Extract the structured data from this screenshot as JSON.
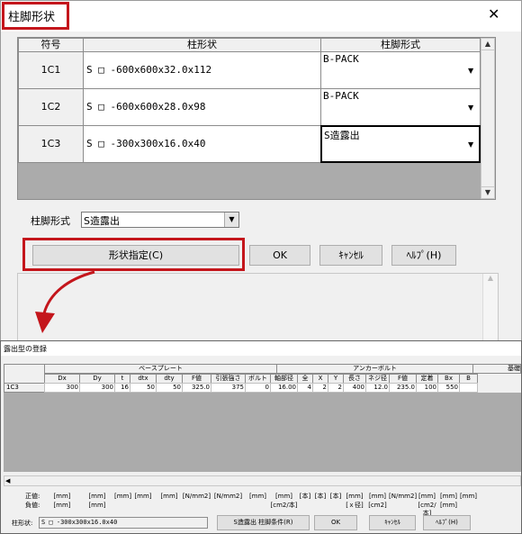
{
  "window": {
    "title": "柱脚形状",
    "close_glyph": "✕"
  },
  "table": {
    "headers": [
      "符号",
      "柱形状",
      "柱脚形式"
    ],
    "rows": [
      {
        "code": "1C1",
        "shape": "S □ -600x600x32.0x112",
        "base": "B-PACK"
      },
      {
        "code": "1C2",
        "shape": "S □ -600x600x28.0x98",
        "base": "B-PACK"
      },
      {
        "code": "1C3",
        "shape": "S □ -300x300x16.0x40",
        "base": "S造露出"
      }
    ]
  },
  "form": {
    "base_type_label": "柱脚形式",
    "base_type_value": "S造露出"
  },
  "buttons": {
    "shape_spec": "形状指定(C)",
    "ok": "OK",
    "cancel": "ｷｬﾝｾﾙ",
    "help": "ﾍﾙﾌﾟ(H)"
  },
  "inset": {
    "title": "露出型の登録",
    "group_baseplate": "ベースプレート",
    "group_anchor": "アンカーボルト",
    "group_base": "基礎",
    "cols": [
      "Dx",
      "Dy",
      "t",
      "dtx",
      "dty",
      "F値",
      "引張強さ",
      "ボルト孔",
      "軸部径",
      "全",
      "X",
      "Y",
      "長さ",
      "ネジ径",
      "F値",
      "定着",
      "Bx",
      "B"
    ],
    "row": {
      "code": "1C3",
      "values": [
        "300",
        "300",
        "16",
        "50",
        "50",
        "325.0",
        "375",
        "0",
        "16.00",
        "4",
        "2",
        "2",
        "400",
        "12.0",
        "235.0",
        "100",
        "550",
        ""
      ]
    },
    "label_pos": "正値:",
    "label_neg": "負値:",
    "units_pos": [
      "[mm]",
      "[mm]",
      "[mm]",
      "[mm]",
      "[mm]",
      "[N/mm2]",
      "[N/mm2]",
      "[mm]",
      "[mm]",
      "[本]",
      "[本]",
      "[本]",
      "[mm]",
      "[mm]",
      "[N/mm2]",
      "[mm]",
      "[mm]",
      "[mm]"
    ],
    "units_neg": [
      "[mm]",
      "[mm]",
      "",
      "",
      "",
      "",
      "",
      "",
      "[cm2/本]",
      "",
      "",
      "",
      "[ｘ径]",
      "[cm2]",
      "",
      "[cm2/本]",
      "[mm]",
      ""
    ],
    "shape_label": "柱形状:",
    "shape_value": "S □ -300x300x16.0x40",
    "btn_condition": "S造露出 柱脚条件(R)",
    "btn_ok": "OK",
    "btn_cancel": "ｷｬﾝｾﾙ",
    "btn_help": "ﾍﾙﾌﾟ(H)"
  },
  "colors": {
    "highlight": "#c4161c",
    "arrow": "#c4161c",
    "grid_empty": "#ababab"
  }
}
